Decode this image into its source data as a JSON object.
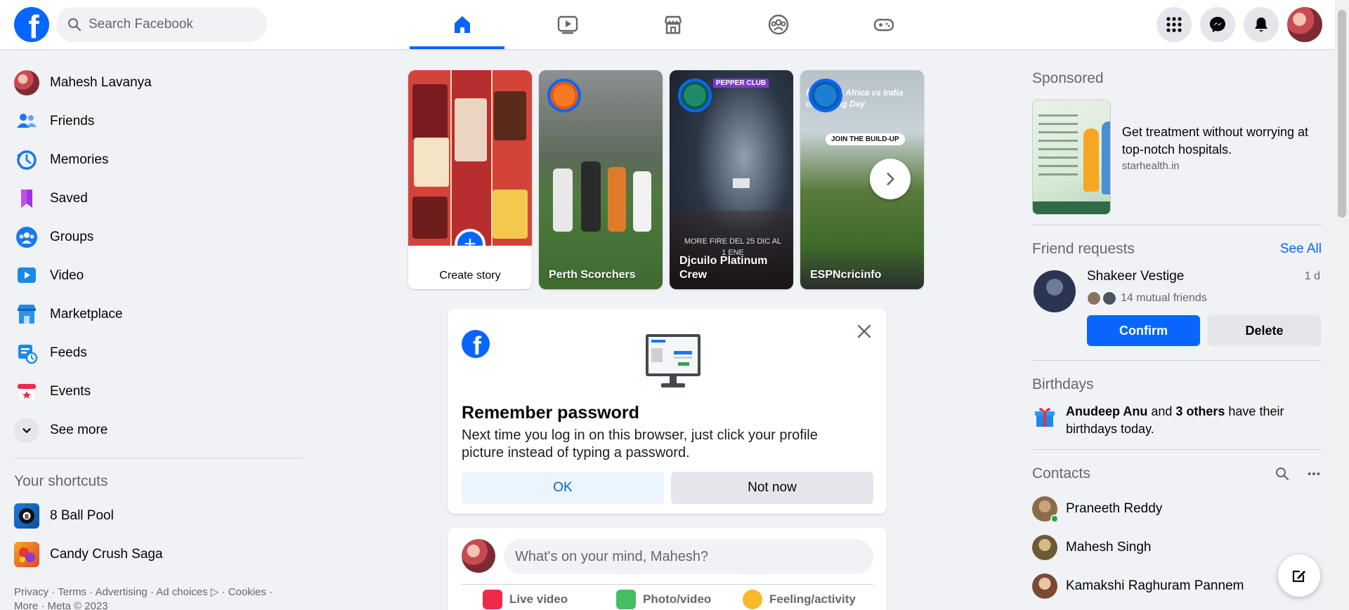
{
  "header": {
    "search_placeholder": "Search Facebook",
    "tabs": [
      {
        "name": "home",
        "active": true
      },
      {
        "name": "video",
        "active": false
      },
      {
        "name": "marketplace",
        "active": false
      },
      {
        "name": "groups",
        "active": false
      },
      {
        "name": "gaming",
        "active": false
      }
    ],
    "right_icons": [
      "menu-grid-icon",
      "messenger-icon",
      "notifications-bell-icon",
      "profile-avatar"
    ]
  },
  "sidebar": {
    "items": [
      {
        "label": "Mahesh Lavanya",
        "icon": "profile-avatar"
      },
      {
        "label": "Friends",
        "icon": "friends-icon"
      },
      {
        "label": "Memories",
        "icon": "memories-clock-icon"
      },
      {
        "label": "Saved",
        "icon": "bookmark-icon"
      },
      {
        "label": "Groups",
        "icon": "groups-icon"
      },
      {
        "label": "Video",
        "icon": "video-icon"
      },
      {
        "label": "Marketplace",
        "icon": "marketplace-icon"
      },
      {
        "label": "Feeds",
        "icon": "feeds-icon"
      },
      {
        "label": "Events",
        "icon": "events-calendar-icon"
      },
      {
        "label": "See more",
        "icon": "chevron-down-icon"
      }
    ],
    "shortcuts_heading": "Your shortcuts",
    "shortcuts": [
      {
        "label": "8 Ball Pool",
        "icon": "8-ball-pool-icon"
      },
      {
        "label": "Candy Crush Saga",
        "icon": "candy-crush-icon"
      }
    ],
    "footer_line1": "Privacy · Terms · Advertising · Ad choices ▷ · Cookies ·",
    "footer_line2": "More · Meta © 2023"
  },
  "stories": {
    "create_label": "Create story",
    "items": [
      {
        "name": "Perth Scorchers",
        "overlay": ""
      },
      {
        "name": "Djcuilo Platinum Crew",
        "overlay": "MORE FIRE  DEL 25 DIC AL 1 ENE",
        "badge": "PEPPER CLUB"
      },
      {
        "name": "ESPNcricinfo",
        "overlay": "for South Africa vs India on Boxing Day",
        "badge": "JOIN THE BUILD-UP"
      }
    ]
  },
  "remember_password": {
    "title": "Remember password",
    "description": "Next time you log in on this browser, just click your profile picture instead of typing a password.",
    "ok_label": "OK",
    "not_now_label": "Not now"
  },
  "composer": {
    "placeholder": "What's on your mind, Mahesh?",
    "actions": [
      "Live video",
      "Photo/video",
      "Feeling/activity"
    ]
  },
  "right": {
    "sponsored_heading": "Sponsored",
    "ad": {
      "text": "Get treatment without worrying at top-notch hospitals.",
      "url": "starhealth.in"
    },
    "friend_requests_heading": "Friend requests",
    "see_all": "See All",
    "request": {
      "name": "Shakeer Vestige",
      "time": "1 d",
      "mutual": "14 mutual friends",
      "confirm": "Confirm",
      "delete": "Delete"
    },
    "birthdays_heading": "Birthdays",
    "birthday": {
      "name": "Anudeep Anu",
      "middle": " and ",
      "others": "3 others",
      "suffix": " have their birthdays today."
    },
    "contacts_heading": "Contacts",
    "contacts": [
      {
        "name": "Praneeth Reddy",
        "online": true
      },
      {
        "name": "Mahesh Singh",
        "online": false
      },
      {
        "name": "Kamakshi Raghuram Pannem",
        "online": false
      }
    ]
  },
  "colors": {
    "brand": "#0866ff",
    "background": "#f0f2f5",
    "secondary_text": "#65676b"
  }
}
